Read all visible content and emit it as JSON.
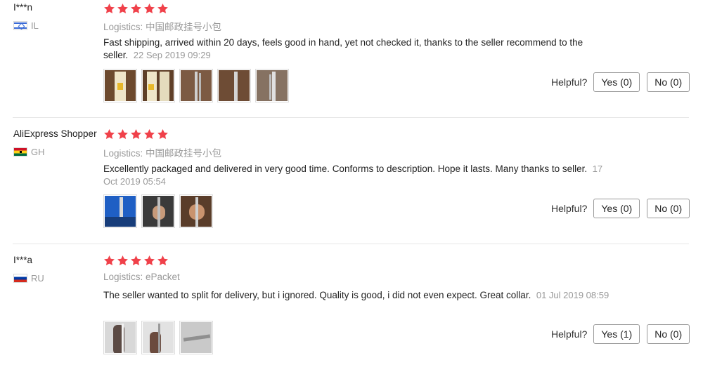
{
  "rating_star_color": "#f0414a",
  "helpful_label": "Helpful?",
  "reviews": [
    {
      "user": "I***n",
      "country": "IL",
      "stars": 5,
      "logistics": "Logistics: 中国邮政挂号小包",
      "text": "Fast shipping, arrived within 20 days, feels good in hand, yet not checked it, thanks to the seller recommend to the seller.",
      "date": "22 Sep 2019 09:29",
      "photo_count": 5,
      "yes_label": "Yes (0)",
      "no_label": "No (0)"
    },
    {
      "user": "AliExpress Shopper",
      "country": "GH",
      "stars": 5,
      "logistics": "Logistics: 中国邮政挂号小包",
      "text": "Excellently packaged and delivered in very good time. Conforms to description. Hope it lasts. Many thanks to seller.",
      "date": "17 Oct 2019 05:54",
      "photo_count": 3,
      "yes_label": "Yes (0)",
      "no_label": "No (0)"
    },
    {
      "user": "I***a",
      "country": "RU",
      "stars": 5,
      "logistics": "Logistics: ePacket",
      "text": "The seller wanted to split for delivery, but i ignored. Quality is good, i did not even expect. Great collar.",
      "date": "01 Jul 2019 08:59",
      "photo_count": 3,
      "yes_label": "Yes (1)",
      "no_label": "No (0)"
    }
  ]
}
